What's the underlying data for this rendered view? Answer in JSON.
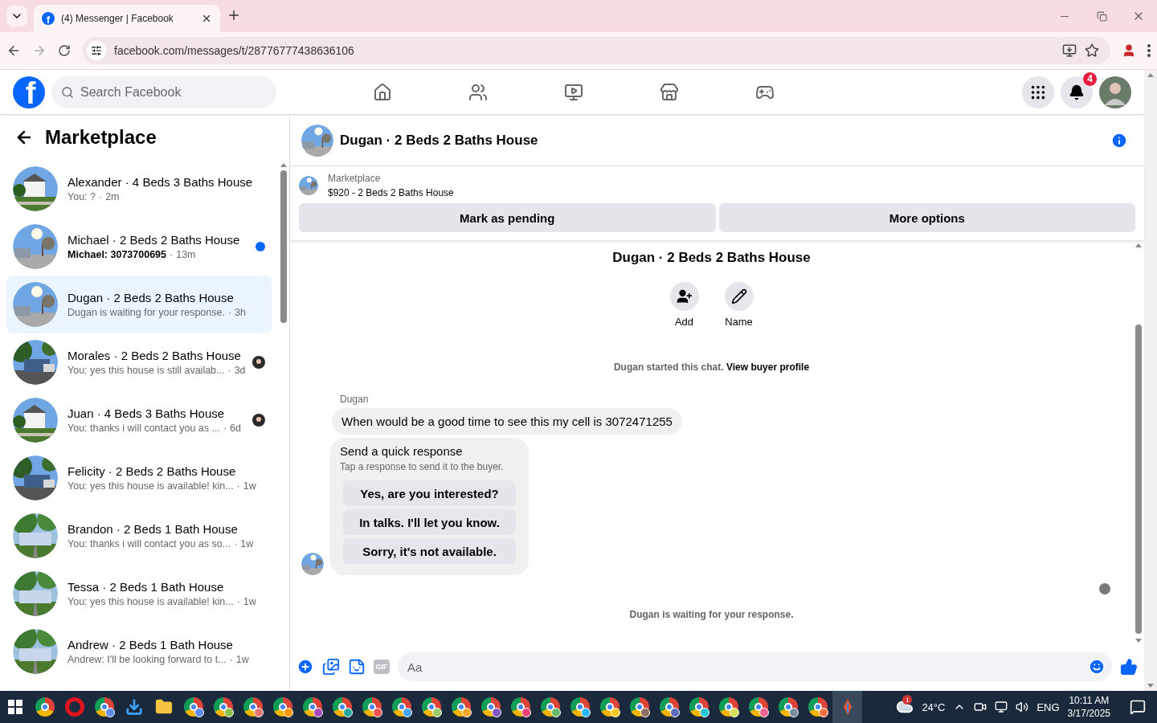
{
  "browser": {
    "tab": {
      "favicon_letter": "f",
      "title": "(4) Messenger | Facebook"
    },
    "url": "facebook.com/messages/t/28776777438636106"
  },
  "nav": {
    "logo_letter": "f",
    "search": {
      "placeholder": "Search Facebook"
    },
    "notifications_badge": "4"
  },
  "sidebar": {
    "title": "Marketplace",
    "conversations": [
      {
        "name": "Alexander · 4 Beds 3 Baths House",
        "preview": "You: ?",
        "separator": "·",
        "time": "2m",
        "unread": false,
        "seen": false,
        "selected": false
      },
      {
        "name": "Michael · 2 Beds 2 Baths House",
        "preview": "Michael: 3073700695",
        "separator": "·",
        "time": "13m",
        "unread": true,
        "seen": false,
        "selected": false
      },
      {
        "name": "Dugan · 2 Beds 2 Baths House",
        "preview": "Dugan is waiting for your response.",
        "separator": "·",
        "time": "3h",
        "unread": false,
        "seen": false,
        "selected": true
      },
      {
        "name": "Morales · 2 Beds 2 Baths House",
        "preview": "You: yes this house is still availab...",
        "separator": "·",
        "time": "3d",
        "unread": false,
        "seen": true,
        "selected": false
      },
      {
        "name": "Juan · 4 Beds 3 Baths House",
        "preview": "You: thanks i will contact you as ...",
        "separator": "·",
        "time": "6d",
        "unread": false,
        "seen": true,
        "selected": false
      },
      {
        "name": "Felicity · 2 Beds 2 Baths House",
        "preview": "You: yes this house is available! kin...",
        "separator": "·",
        "time": "1w",
        "unread": false,
        "seen": false,
        "selected": false
      },
      {
        "name": "Brandon · 2 Beds 1 Bath House",
        "preview": "You: thanks i will contact you as so...",
        "separator": "·",
        "time": "1w",
        "unread": false,
        "seen": false,
        "selected": false
      },
      {
        "name": "Tessa · 2 Beds 1 Bath House",
        "preview": "You: yes this house is available! kin...",
        "separator": "·",
        "time": "1w",
        "unread": false,
        "seen": false,
        "selected": false
      },
      {
        "name": "Andrew · 2 Beds 1 Bath House",
        "preview": "Andrew: I'll be looking forward to t...",
        "separator": "·",
        "time": "1w",
        "unread": false,
        "seen": false,
        "selected": false
      }
    ]
  },
  "chat": {
    "title": "Dugan · 2 Beds 2 Baths House",
    "listing": {
      "source": "Marketplace",
      "summary": "$920 - 2 Beds 2 Baths House",
      "actions": [
        "Mark as pending",
        "More options"
      ]
    },
    "profile": {
      "title": "Dugan · 2 Beds 2 Baths House",
      "actions": [
        {
          "kind": "add",
          "label": "Add"
        },
        {
          "kind": "name",
          "label": "Name"
        }
      ]
    },
    "started_note": {
      "text": "Dugan started this chat.",
      "link": "View buyer profile"
    },
    "messages": [
      {
        "sender": "Dugan",
        "text": "When would be a good time to see this my cell is 3072471255"
      }
    ],
    "quick_response": {
      "title": "Send a quick response",
      "subtitle": "Tap a response to send it to the buyer.",
      "options": [
        "Yes, are you interested?",
        "In talks. I'll let you know.",
        "Sorry, it's not available."
      ]
    },
    "status_note": "Dugan is waiting for your response.",
    "composer": {
      "gif_label": "GIF",
      "placeholder": "Aa"
    }
  },
  "taskbar": {
    "weather_badge": "1",
    "temperature": "24°C",
    "language": "ENG",
    "time": "10:11 AM",
    "date": "3/17/2025"
  }
}
